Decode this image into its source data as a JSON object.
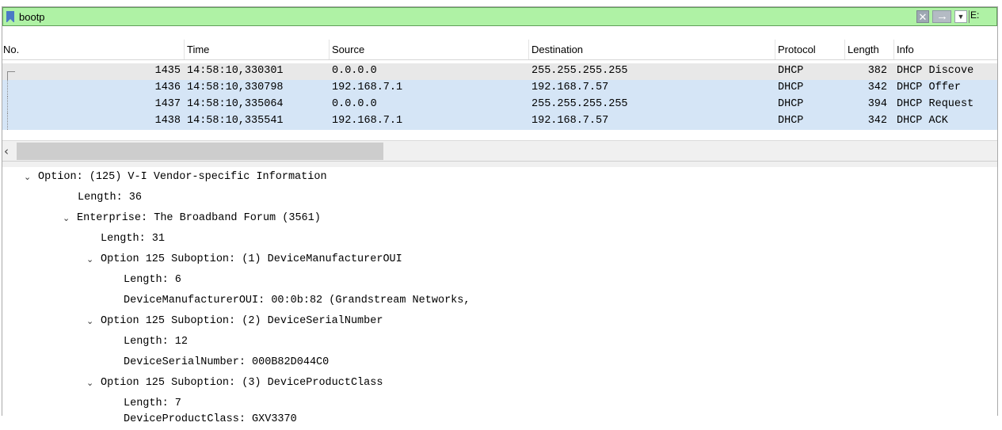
{
  "filter": {
    "value": "bootp",
    "extra_label": "E:"
  },
  "columns": [
    "No.",
    "Time",
    "Source",
    "Destination",
    "Protocol",
    "Length",
    "Info"
  ],
  "packets": [
    {
      "no": "1435",
      "time": "14:58:10,330301",
      "source": "0.0.0.0",
      "destination": "255.255.255.255",
      "protocol": "DHCP",
      "length": "382",
      "info": "DHCP Discove"
    },
    {
      "no": "1436",
      "time": "14:58:10,330798",
      "source": "192.168.7.1",
      "destination": "192.168.7.57",
      "protocol": "DHCP",
      "length": "342",
      "info": "DHCP Offer"
    },
    {
      "no": "1437",
      "time": "14:58:10,335064",
      "source": "0.0.0.0",
      "destination": "255.255.255.255",
      "protocol": "DHCP",
      "length": "394",
      "info": "DHCP Request"
    },
    {
      "no": "1438",
      "time": "14:58:10,335541",
      "source": "192.168.7.1",
      "destination": "192.168.7.57",
      "protocol": "DHCP",
      "length": "342",
      "info": "DHCP ACK"
    }
  ],
  "details": [
    "Option: (125) V-I Vendor-specific Information",
    "Length: 36",
    "Enterprise: The Broadband Forum (3561)",
    "Length: 31",
    "Option 125 Suboption: (1) DeviceManufacturerOUI",
    "Length: 6",
    "DeviceManufacturerOUI: 00:0b:82 (Grandstream Networks,",
    "Option 125 Suboption: (2) DeviceSerialNumber",
    "Length: 12",
    "DeviceSerialNumber: 000B82D044C0",
    "Option 125 Suboption: (3) DeviceProductClass",
    "Length: 7",
    "DeviceProductClass: GXV3370"
  ],
  "colors": {
    "filter_ok": "#aff2a5",
    "selected_row": "#d5e5f6",
    "current_row": "#e8e8e8"
  },
  "icons": [
    "bookmark-icon",
    "clear-filter-icon",
    "apply-filter-arrow-icon",
    "chevron-down-icon",
    "scroll-left-arrow-icon",
    "expanded-chevron-icon"
  ]
}
